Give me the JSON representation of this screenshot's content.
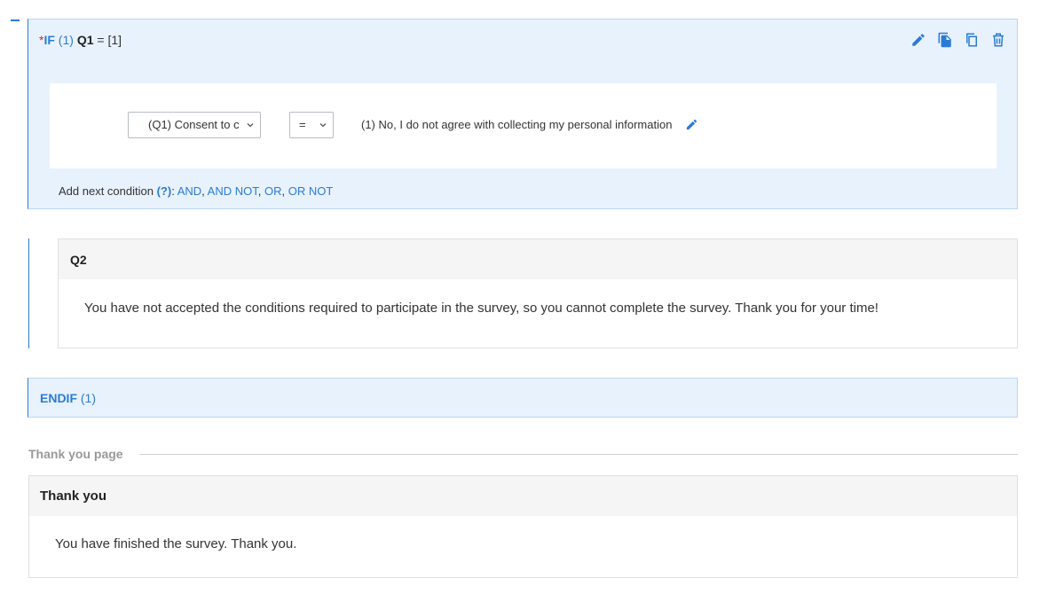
{
  "if_block": {
    "star": "*",
    "keyword": "IF",
    "number": "(1)",
    "question": "Q1",
    "condition": " = [1]",
    "tools": [
      "edit-icon",
      "copy-icon",
      "duplicate-icon",
      "trash-icon"
    ],
    "condition_row": {
      "question_select": "(Q1) Consent to c",
      "operator_select": "=",
      "value": "(1) No, I do not agree with collecting my personal information"
    },
    "add_next": {
      "label": "Add next condition ",
      "help": "(?)",
      "colon": ": ",
      "options": [
        "AND",
        "AND NOT",
        "OR",
        "OR NOT"
      ]
    }
  },
  "q2": {
    "title": "Q2",
    "text": "You have not accepted the conditions required to participate in the survey, so you cannot complete the survey. Thank you for your time!"
  },
  "endif": {
    "keyword": "ENDIF",
    "number": "(1)"
  },
  "thank_you_page": {
    "section_label": "Thank you page",
    "title": "Thank you",
    "text": "You have finished the survey. Thank you."
  },
  "colors": {
    "accent": "#2b7bd6",
    "block_bg": "#e8f2fd",
    "required_star": "#e02020"
  }
}
